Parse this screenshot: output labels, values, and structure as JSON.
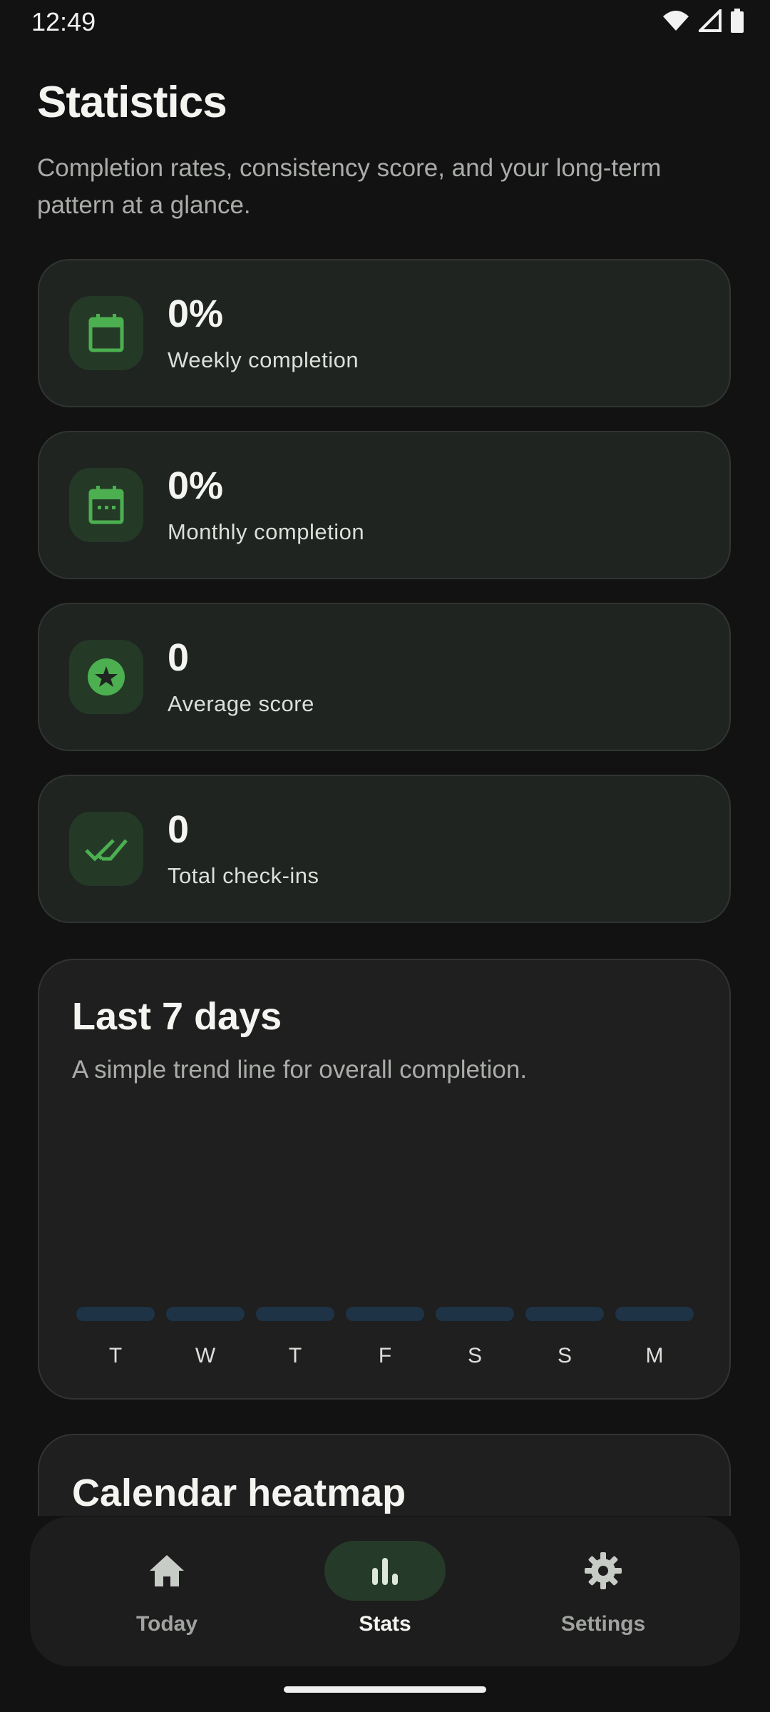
{
  "status_bar": {
    "time": "12:49"
  },
  "header": {
    "title": "Statistics",
    "subtitle": "Completion rates, consistency score, and your long-term pattern at a glance."
  },
  "stats": [
    {
      "value": "0%",
      "label": "Weekly completion",
      "icon": "calendar-icon"
    },
    {
      "value": "0%",
      "label": "Monthly completion",
      "icon": "calendar-month-icon"
    },
    {
      "value": "0",
      "label": "Average score",
      "icon": "star-badge-icon"
    },
    {
      "value": "0",
      "label": "Total check-ins",
      "icon": "double-check-icon"
    }
  ],
  "trend": {
    "title": "Last 7 days",
    "subtitle": "A simple trend line for overall completion."
  },
  "chart_data": {
    "type": "bar",
    "categories": [
      "T",
      "W",
      "T",
      "F",
      "S",
      "S",
      "M"
    ],
    "values": [
      0,
      0,
      0,
      0,
      0,
      0,
      0
    ],
    "ylim": [
      0,
      100
    ]
  },
  "heatmap": {
    "title": "Calendar heatmap"
  },
  "nav": {
    "items": [
      {
        "label": "Today",
        "icon": "home-icon",
        "active": false
      },
      {
        "label": "Stats",
        "icon": "bar-chart-icon",
        "active": true
      },
      {
        "label": "Settings",
        "icon": "gear-icon",
        "active": false
      }
    ]
  },
  "colors": {
    "accent": "#4CAF50",
    "bar_track": "#1E3346",
    "card": "#1F2421",
    "background": "#121212"
  }
}
